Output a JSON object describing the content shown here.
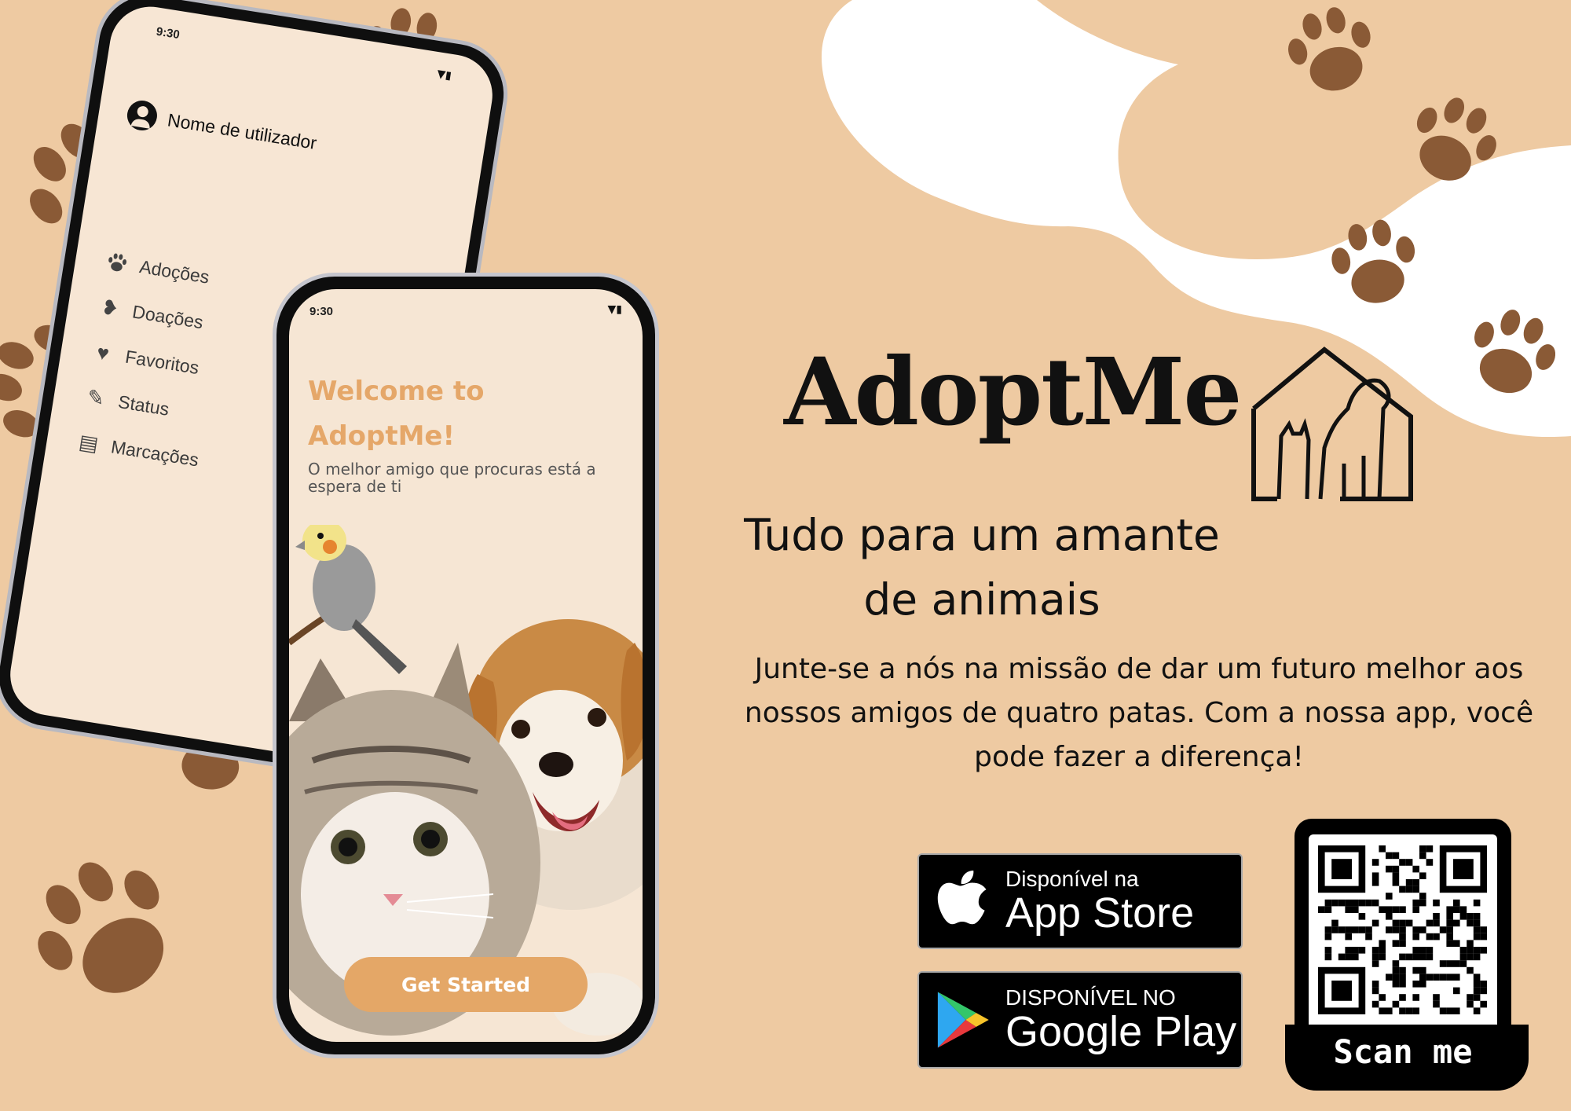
{
  "colors": {
    "background": "#eecaa2",
    "paw": "#8a5a36",
    "accent": "#e4a767",
    "screen": "#f6e6d4"
  },
  "back_phone": {
    "status_time": "9:30",
    "username": "Nome de utilizador",
    "menu": [
      {
        "label": "Adoções",
        "icon": "paw-icon"
      },
      {
        "label": "Doações",
        "icon": "heart-hand-icon"
      },
      {
        "label": "Favoritos",
        "icon": "heart-icon"
      },
      {
        "label": "Status",
        "icon": "edit-icon"
      },
      {
        "label": "Marcações",
        "icon": "calendar-icon"
      }
    ]
  },
  "front_phone": {
    "status_time": "9:30",
    "welcome_line1": "Welcome to",
    "welcome_line2": "AdoptMe!",
    "tagline": "O melhor amigo que procuras está a espera de ti",
    "cta": "Get Started"
  },
  "brand": {
    "name": "AdoptMe",
    "subtitle_line1": "Tudo para um amante",
    "subtitle_line2": "de animais",
    "description": "Junte-se a nós na missão de dar um futuro melhor aos nossos amigos de quatro patas. Com a nossa app, você pode fazer a diferença!"
  },
  "stores": {
    "apple_small": "Disponível na",
    "apple_big": "App Store",
    "google_small": "DISPONÍVEL NO",
    "google_big": "Google Play"
  },
  "qr": {
    "label": "Scan me"
  }
}
